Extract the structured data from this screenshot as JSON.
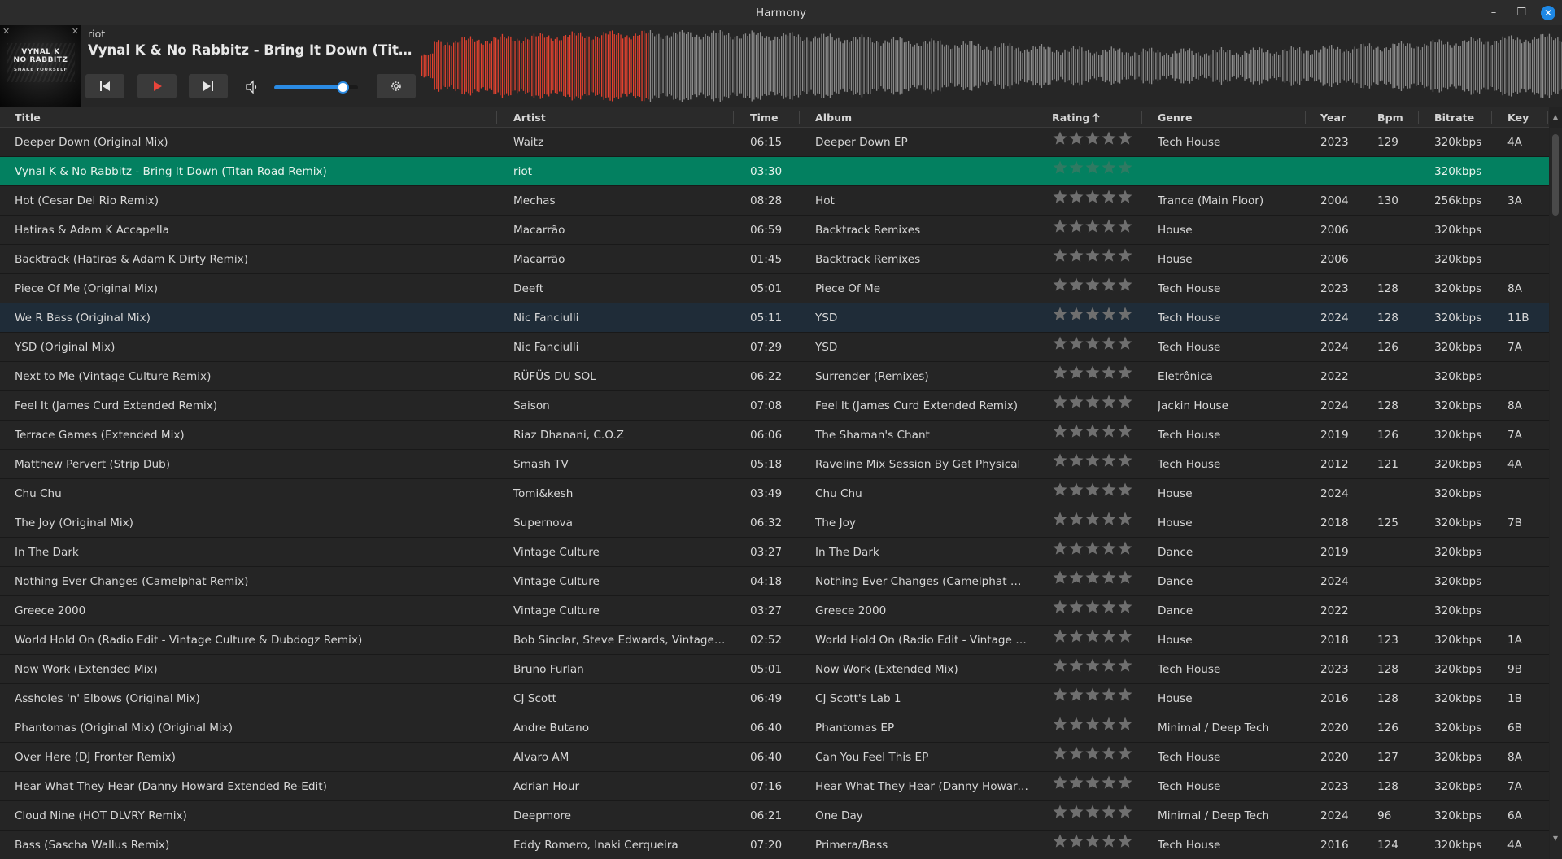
{
  "window": {
    "title": "Harmony"
  },
  "player": {
    "cover_art": {
      "line1": "VYNAL K",
      "line2": "NO RABBITZ",
      "line3": "SHAKE YOURSELF"
    },
    "artist": "riot",
    "title": "Vynal K & No Rabbitz - Bring It Down (Titan Road Remix)",
    "volume_fraction": 0.82,
    "progress_fraction": 0.2,
    "waveform": {
      "played_color": "#e2422f",
      "unplayed_color": "#8c8c8c"
    },
    "icons": [
      "previous-icon",
      "play-icon",
      "next-icon",
      "volume-icon",
      "settings-icon"
    ]
  },
  "table": {
    "columns": [
      "Title",
      "Artist",
      "Time",
      "Album",
      "Rating",
      "Genre",
      "Year",
      "Bpm",
      "Bitrate",
      "Key"
    ],
    "sort": {
      "column": "Rating",
      "direction": "ascending"
    },
    "rows": [
      [
        "Deeper Down (Original Mix)",
        "Waitz",
        "06:15",
        "Deeper Down EP",
        "",
        "Tech House",
        "2023",
        "129",
        "320kbps",
        "4A"
      ],
      [
        "Vynal K & No Rabbitz - Bring It Down (Titan Road Remix)",
        "riot",
        "03:30",
        "",
        "",
        "",
        "",
        "",
        "320kbps",
        ""
      ],
      [
        "Hot (Cesar Del Rio Remix)",
        "Mechas",
        "08:28",
        "Hot",
        "",
        "Trance (Main Floor)",
        "2004",
        "130",
        "256kbps",
        "3A"
      ],
      [
        "Hatiras & Adam K Accapella",
        "Macarrão",
        "06:59",
        "Backtrack Remixes",
        "",
        "House",
        "2006",
        "",
        "320kbps",
        ""
      ],
      [
        "Backtrack (Hatiras & Adam K Dirty Remix)",
        "Macarrão",
        "01:45",
        "Backtrack Remixes",
        "",
        "House",
        "2006",
        "",
        "320kbps",
        ""
      ],
      [
        "Piece Of Me (Original Mix)",
        "Deeft",
        "05:01",
        "Piece Of Me",
        "",
        "Tech House",
        "2023",
        "128",
        "320kbps",
        "8A"
      ],
      [
        "We R Bass (Original Mix)",
        "Nic Fanciulli",
        "05:11",
        "YSD",
        "",
        "Tech House",
        "2024",
        "128",
        "320kbps",
        "11B"
      ],
      [
        "YSD (Original Mix)",
        "Nic Fanciulli",
        "07:29",
        "YSD",
        "",
        "Tech House",
        "2024",
        "126",
        "320kbps",
        "7A"
      ],
      [
        "Next to Me (Vintage Culture Remix)",
        "RÜFÜS DU SOL",
        "06:22",
        "Surrender (Remixes)",
        "",
        "Eletrônica",
        "2022",
        "",
        "320kbps",
        ""
      ],
      [
        "Feel It (James Curd Extended Remix)",
        "Saison",
        "07:08",
        "Feel It (James Curd Extended Remix)",
        "",
        "Jackin House",
        "2024",
        "128",
        "320kbps",
        "8A"
      ],
      [
        "Terrace Games (Extended Mix)",
        "Riaz Dhanani, C.O.Z",
        "06:06",
        "The Shaman's Chant",
        "",
        "Tech House",
        "2019",
        "126",
        "320kbps",
        "7A"
      ],
      [
        "Matthew Pervert (Strip Dub)",
        "Smash TV",
        "05:18",
        "Raveline Mix Session By Get Physical",
        "",
        "Tech House",
        "2012",
        "121",
        "320kbps",
        "4A"
      ],
      [
        "Chu Chu",
        "Tomi&kesh",
        "03:49",
        "Chu Chu",
        "",
        "House",
        "2024",
        "",
        "320kbps",
        ""
      ],
      [
        "The Joy (Original Mix)",
        "Supernova",
        "06:32",
        "The Joy",
        "",
        "House",
        "2018",
        "125",
        "320kbps",
        "7B"
      ],
      [
        "In The Dark",
        "Vintage Culture",
        "03:27",
        "In The Dark",
        "",
        "Dance",
        "2019",
        "",
        "320kbps",
        ""
      ],
      [
        "Nothing Ever Changes (Camelphat Remix)",
        "Vintage Culture",
        "04:18",
        "Nothing Ever Changes (Camelphat Re...",
        "",
        "Dance",
        "2024",
        "",
        "320kbps",
        ""
      ],
      [
        "Greece 2000",
        "Vintage Culture",
        "03:27",
        "Greece 2000",
        "",
        "Dance",
        "2022",
        "",
        "320kbps",
        ""
      ],
      [
        "World Hold On (Radio Edit - Vintage Culture & Dubdogz Remix)",
        "Bob Sinclar, Steve Edwards, Vintage C...",
        "02:52",
        "World Hold On (Radio Edit - Vintage C...",
        "",
        "House",
        "2018",
        "123",
        "320kbps",
        "1A"
      ],
      [
        "Now Work (Extended Mix)",
        "Bruno Furlan",
        "05:01",
        "Now Work (Extended Mix)",
        "",
        "Tech House",
        "2023",
        "128",
        "320kbps",
        "9B"
      ],
      [
        "Assholes 'n' Elbows (Original Mix)",
        "CJ Scott",
        "06:49",
        "CJ Scott's Lab 1",
        "",
        "House",
        "2016",
        "128",
        "320kbps",
        "1B"
      ],
      [
        "Phantomas (Original Mix) (Original Mix)",
        "Andre Butano",
        "06:40",
        "Phantomas EP",
        "",
        "Minimal / Deep Tech",
        "2020",
        "126",
        "320kbps",
        "6B"
      ],
      [
        "Over Here (DJ Fronter Remix)",
        "Alvaro AM",
        "06:40",
        "Can You Feel This EP",
        "",
        "Tech House",
        "2020",
        "127",
        "320kbps",
        "8A"
      ],
      [
        "Hear What They Hear (Danny Howard Extended Re-Edit)",
        "Adrian Hour",
        "07:16",
        "Hear What They Hear (Danny Howard ...",
        "",
        "Tech House",
        "2023",
        "128",
        "320kbps",
        "7A"
      ],
      [
        "Cloud Nine (HOT DLVRY Remix)",
        "Deepmore",
        "06:21",
        "One Day",
        "",
        "Minimal / Deep Tech",
        "2024",
        "96",
        "320kbps",
        "6A"
      ],
      [
        "Bass (Sascha Wallus Remix)",
        "Eddy Romero, Inaki Cerqueira",
        "07:20",
        "Primera/Bass",
        "",
        "Tech House",
        "2016",
        "124",
        "320kbps",
        "4A"
      ],
      [
        "",
        "",
        "",
        "",
        "",
        "",
        "",
        "",
        "",
        ""
      ]
    ],
    "playing_row": 1,
    "hover_row": 6
  }
}
